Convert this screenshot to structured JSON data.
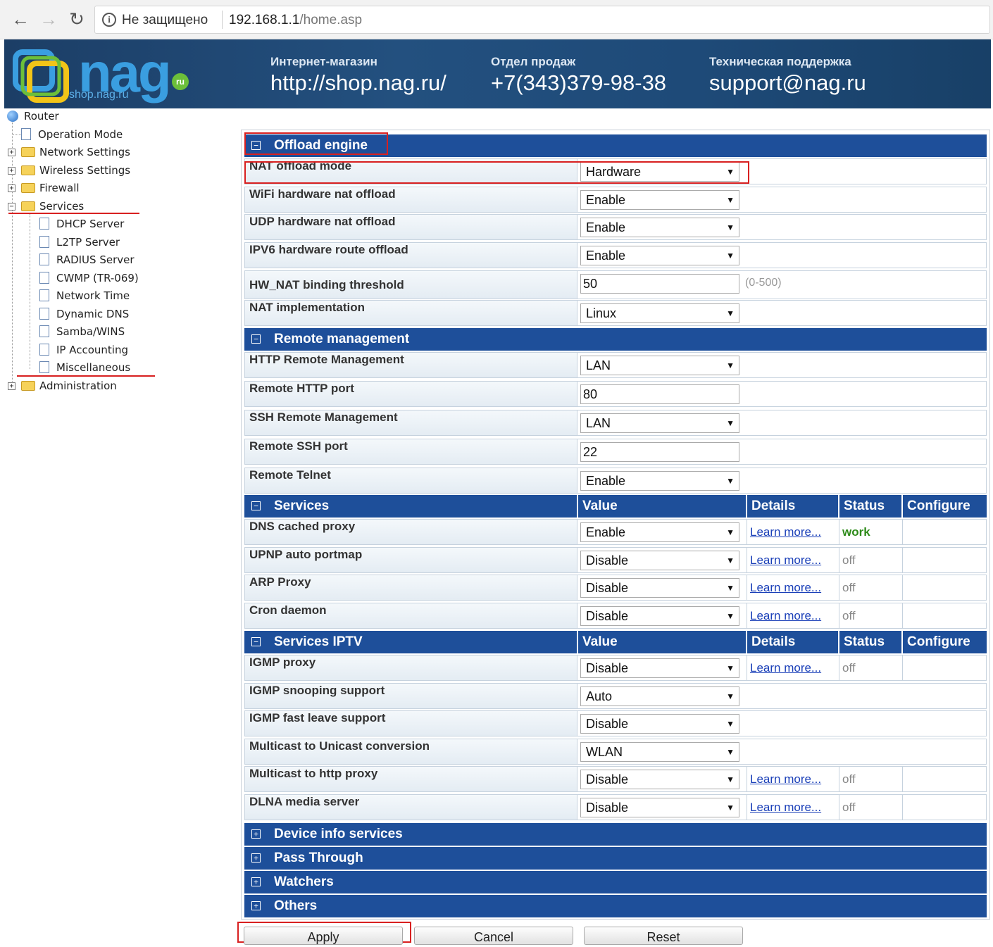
{
  "browser": {
    "security_text": "Не защищено",
    "url_host": "192.168.1.1",
    "url_path": "/home.asp"
  },
  "banner": {
    "logo_word": "nag",
    "logo_sub": "shop.nag.ru",
    "logo_ru": "ru",
    "shop_label": "Интернет-магазин",
    "shop_value": "http://shop.nag.ru/",
    "sales_label": "Отдел продаж",
    "sales_value": "+7(343)379-98-38",
    "support_label": "Техническая поддержка",
    "support_value": "support@nag.ru"
  },
  "tree": {
    "root": "Router",
    "operation_mode": "Operation Mode",
    "network_settings": "Network Settings",
    "wireless_settings": "Wireless Settings",
    "firewall": "Firewall",
    "services": "Services",
    "service_items": [
      "DHCP Server",
      "L2TP Server",
      "RADIUS Server",
      "CWMP (TR-069)",
      "Network Time",
      "Dynamic DNS",
      "Samba/WINS",
      "IP Accounting",
      "Miscellaneous"
    ],
    "administration": "Administration"
  },
  "sections": {
    "offload": "Offload engine",
    "remote": "Remote management",
    "services": "Services",
    "iptv": "Services IPTV",
    "device_info": "Device info services",
    "pass_through": "Pass Through",
    "watchers": "Watchers",
    "others": "Others"
  },
  "columns": {
    "value": "Value",
    "details": "Details",
    "status": "Status",
    "configure": "Configure"
  },
  "offload_rows": [
    {
      "label": "NAT offload mode",
      "value": "Hardware"
    },
    {
      "label": "WiFi hardware nat offload",
      "value": "Enable"
    },
    {
      "label": "UDP hardware nat offload",
      "value": "Enable"
    },
    {
      "label": "IPV6 hardware route offload",
      "value": "Enable"
    },
    {
      "label": "HW_NAT binding threshold",
      "value": "50",
      "hint": "(0-500)"
    },
    {
      "label": "NAT implementation",
      "value": "Linux"
    }
  ],
  "remote_rows": [
    {
      "label": "HTTP Remote Management",
      "value": "LAN"
    },
    {
      "label": "Remote HTTP port",
      "value": "80"
    },
    {
      "label": "SSH Remote Management",
      "value": "LAN"
    },
    {
      "label": "Remote SSH port",
      "value": "22"
    },
    {
      "label": "Remote Telnet",
      "value": "Enable"
    }
  ],
  "learn_more": "Learn more...",
  "services_rows": [
    {
      "label": "DNS cached proxy",
      "value": "Enable",
      "status": "work"
    },
    {
      "label": "UPNP auto portmap",
      "value": "Disable",
      "status": "off"
    },
    {
      "label": "ARP Proxy",
      "value": "Disable",
      "status": "off"
    },
    {
      "label": "Cron daemon",
      "value": "Disable",
      "status": "off"
    }
  ],
  "iptv_rows": [
    {
      "label": "IGMP proxy",
      "value": "Disable",
      "status": "off"
    },
    {
      "label": "IGMP snooping support",
      "value": "Auto"
    },
    {
      "label": "IGMP fast leave support",
      "value": "Disable"
    },
    {
      "label": "Multicast to Unicast conversion",
      "value": "WLAN"
    },
    {
      "label": "Multicast to http proxy",
      "value": "Disable",
      "status": "off"
    },
    {
      "label": "DLNA media server",
      "value": "Disable",
      "status": "off"
    }
  ],
  "buttons": {
    "apply": "Apply",
    "cancel": "Cancel",
    "reset": "Reset"
  }
}
